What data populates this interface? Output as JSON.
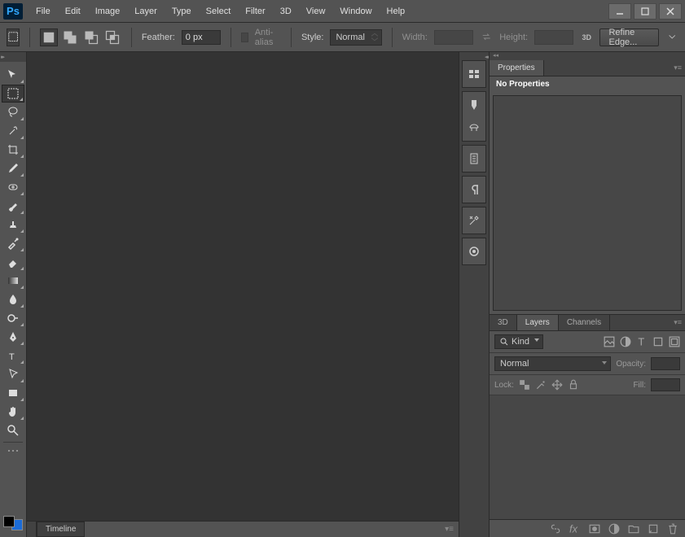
{
  "app": {
    "name": "Ps"
  },
  "menu": [
    "File",
    "Edit",
    "Image",
    "Layer",
    "Type",
    "Select",
    "Filter",
    "3D",
    "View",
    "Window",
    "Help"
  ],
  "options": {
    "feather_label": "Feather:",
    "feather_value": "0 px",
    "antialias_label": "Anti-alias",
    "style_label": "Style:",
    "style_value": "Normal",
    "width_label": "Width:",
    "height_label": "Height:",
    "refine_label": "Refine Edge..."
  },
  "timeline": {
    "tab": "Timeline"
  },
  "properties": {
    "tab": "Properties",
    "empty": "No Properties"
  },
  "layers": {
    "tabs": [
      "3D",
      "Layers",
      "Channels"
    ],
    "active_tab": 1,
    "kind_label": "Kind",
    "blend_value": "Normal",
    "opacity_label": "Opacity:",
    "lock_label": "Lock:",
    "fill_label": "Fill:"
  }
}
